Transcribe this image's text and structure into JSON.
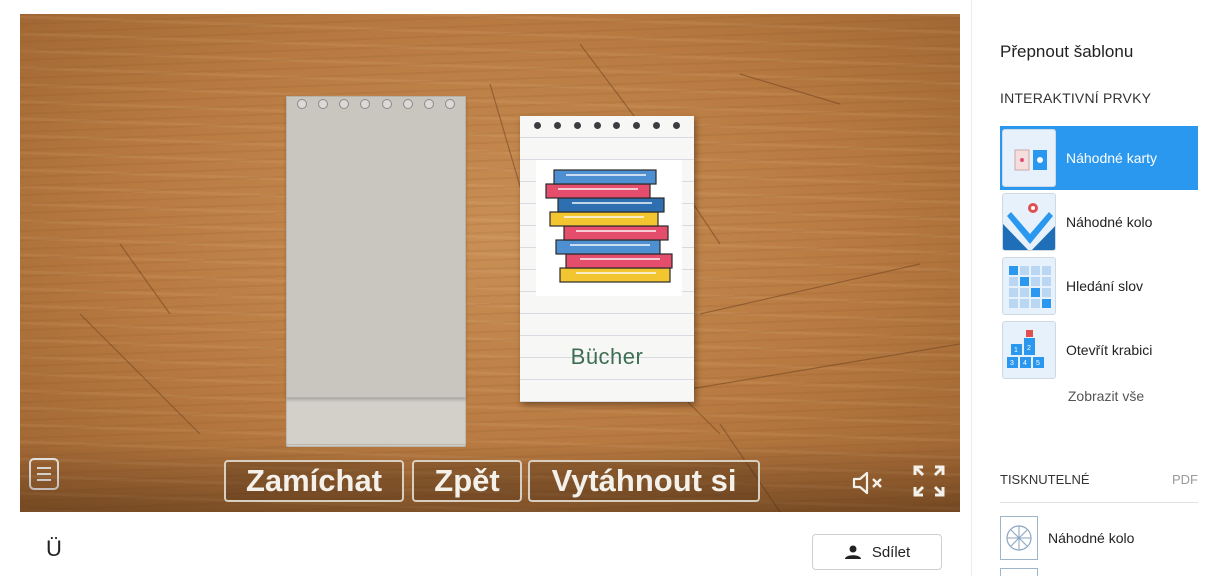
{
  "game": {
    "card_word": "Bücher",
    "controls": {
      "shuffle": "Zamíchat",
      "back": "Zpět",
      "draw": "Vytáhnout si"
    },
    "icons": {
      "menu": "menu-icon",
      "mute": "volume-mute-icon",
      "fullscreen": "fullscreen-icon",
      "card_image": "stack-of-books-image"
    }
  },
  "page": {
    "title": "Ü",
    "share_label": "Sdílet"
  },
  "panel": {
    "switch_template": "Přepnout šablonu",
    "interactive_heading": "INTERAKTIVNÍ PRVKY",
    "templates": [
      {
        "label": "Náhodné karty",
        "active": true
      },
      {
        "label": "Náhodné kolo",
        "active": false
      },
      {
        "label": "Hledání slov",
        "active": false
      },
      {
        "label": "Otevřít krabici",
        "active": false
      }
    ],
    "show_all": "Zobrazit vše",
    "printable_heading": "TISKNUTELNÉ",
    "pdf_label": "PDF",
    "printables": [
      {
        "label": "Náhodné kolo"
      }
    ]
  },
  "colors": {
    "accent": "#2b98ef",
    "card_word": "#3d6e51",
    "wood": "#b87a41"
  }
}
